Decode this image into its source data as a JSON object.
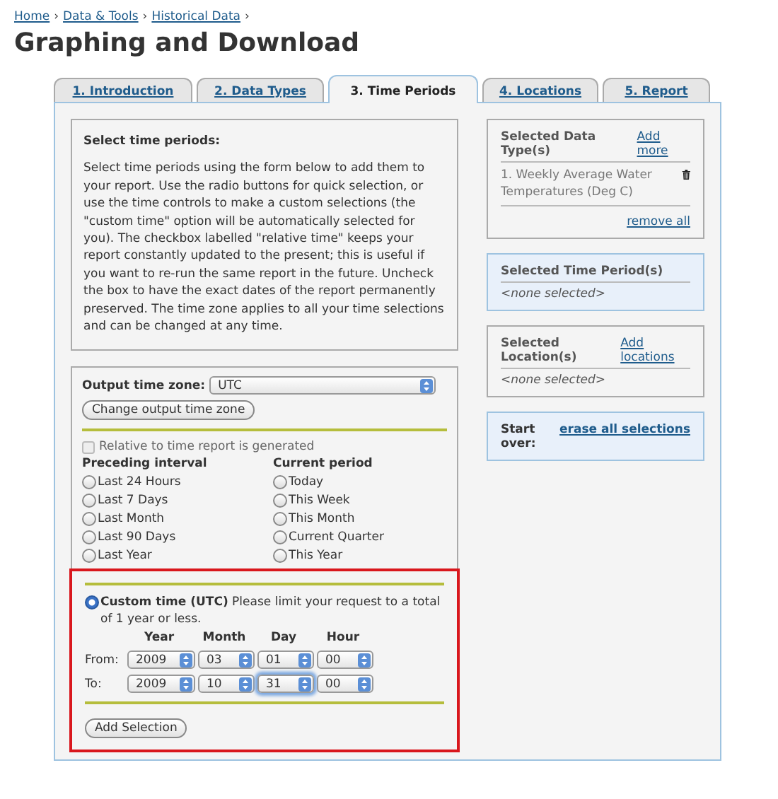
{
  "breadcrumb": {
    "separator": "›",
    "links": [
      "Home",
      "Data & Tools",
      "Historical Data"
    ]
  },
  "title": "Graphing and Download",
  "tabs": [
    {
      "label": "1. Introduction",
      "selected": false
    },
    {
      "label": "2. Data Types",
      "selected": false
    },
    {
      "label": "3. Time Periods",
      "selected": true
    },
    {
      "label": "4. Locations",
      "selected": false
    },
    {
      "label": "5. Report",
      "selected": false
    }
  ],
  "instructions": {
    "title": "Select time periods:",
    "body": "Select time periods using the form below to add them to your report. Use the radio buttons for quick selection, or use the time controls to make a custom selections (the \"custom time\" option will be automatically selected for you). The checkbox labelled \"relative time\" keeps your report constantly updated to the present; this is useful if you want to re-run the same report in the future. Uncheck the box to have the exact dates of the report permanently preserved. The time zone applies to all your time selections and can be changed at any time."
  },
  "timezone": {
    "label": "Output time zone:",
    "value": "UTC",
    "button": "Change output time zone"
  },
  "relative": {
    "label": "Relative to time report is generated",
    "checked": false,
    "disabled": true
  },
  "groups": [
    {
      "heading": "Preceding interval",
      "options": [
        {
          "label": "Last 24 Hours",
          "selected": false
        },
        {
          "label": "Last 7 Days",
          "selected": false
        },
        {
          "label": "Last Month",
          "selected": false
        },
        {
          "label": "Last 90 Days",
          "selected": false
        },
        {
          "label": "Last Year",
          "selected": false
        }
      ]
    },
    {
      "heading": "Current period",
      "options": [
        {
          "label": "Today",
          "selected": false
        },
        {
          "label": "This Week",
          "selected": false
        },
        {
          "label": "This Month",
          "selected": false
        },
        {
          "label": "Current Quarter",
          "selected": false
        },
        {
          "label": "This Year",
          "selected": false
        }
      ]
    }
  ],
  "custom": {
    "selected": true,
    "text": "**Custom time (UTC)** Please limit your request to a total of 1 year or less.",
    "columns": [
      "Year",
      "Month",
      "Day",
      "Hour"
    ],
    "rows": [
      {
        "label": "From:",
        "fields": [
          {
            "value": "2009",
            "focused": false
          },
          {
            "value": "03",
            "focused": false
          },
          {
            "value": "01",
            "focused": false
          },
          {
            "value": "00",
            "focused": false
          }
        ]
      },
      {
        "label": "To:",
        "fields": [
          {
            "value": "2009",
            "focused": false
          },
          {
            "value": "10",
            "focused": false
          },
          {
            "value": "31",
            "focused": true
          },
          {
            "value": "00",
            "focused": false
          }
        ]
      }
    ],
    "button": "Add Selection"
  },
  "sidebar": [
    {
      "kind": "list",
      "title": "Selected Data Type(s)",
      "link": "Add more",
      "highlighted": false,
      "items": [
        {
          "text": "1. Weekly Average Water Temperatures (Deg C)",
          "deletable": true
        }
      ],
      "footer_link": "remove all"
    },
    {
      "kind": "list",
      "title": "Selected Time Period(s)",
      "highlighted": true,
      "empty": "<none selected>"
    },
    {
      "kind": "list",
      "title": "Selected Location(s)",
      "link": "Add locations",
      "highlighted": false,
      "empty": "<none selected>"
    },
    {
      "kind": "inline",
      "title": "Start over:",
      "link": "erase all selections",
      "highlighted": true
    }
  ]
}
